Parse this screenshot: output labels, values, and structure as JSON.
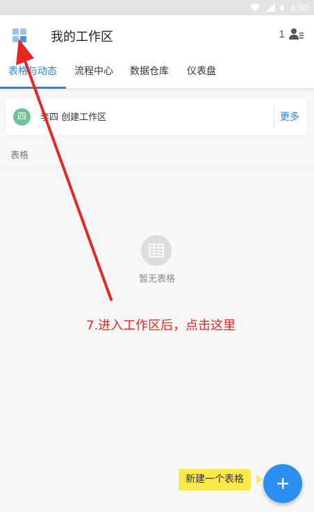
{
  "status_bar": {
    "time": "6:00"
  },
  "header": {
    "title": "我的工作区",
    "member_count": "1"
  },
  "tabs": [
    {
      "label": "表格与动态",
      "active": true
    },
    {
      "label": "流程中心",
      "active": false
    },
    {
      "label": "数据仓库",
      "active": false
    },
    {
      "label": "仪表盘",
      "active": false
    }
  ],
  "workspace": {
    "avatar": "四",
    "text": "李四 创建工作区",
    "more_label": "更多"
  },
  "section": {
    "label": "表格"
  },
  "empty_state": {
    "text": "暂无表格"
  },
  "annotation": {
    "text": "7.进入工作区后，点击这里"
  },
  "fab": {
    "tooltip": "新建一个表格",
    "icon": "plus-icon"
  },
  "colors": {
    "accent": "#2a86d9",
    "fab": "#2a8ff0",
    "avatar": "#6cc497",
    "annotation_red": "#e8261f",
    "tooltip": "#fbe84a"
  }
}
